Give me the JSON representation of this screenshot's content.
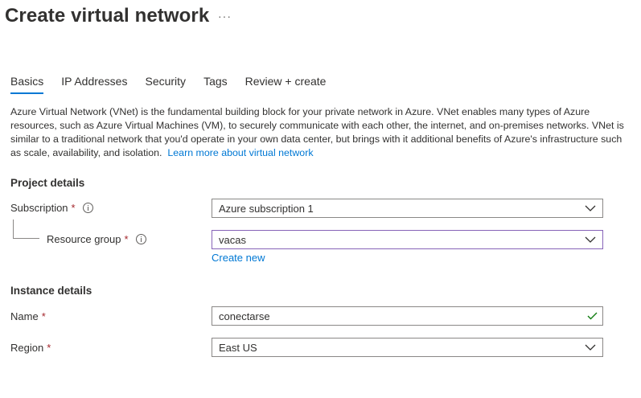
{
  "page": {
    "title": "Create virtual network",
    "more_label": "···"
  },
  "tabs": [
    {
      "label": "Basics",
      "active": true
    },
    {
      "label": "IP Addresses",
      "active": false
    },
    {
      "label": "Security",
      "active": false
    },
    {
      "label": "Tags",
      "active": false
    },
    {
      "label": "Review + create",
      "active": false
    }
  ],
  "description": {
    "text": "Azure Virtual Network (VNet) is the fundamental building block for your private network in Azure. VNet enables many types of Azure resources, such as Azure Virtual Machines (VM), to securely communicate with each other, the internet, and on-premises networks. VNet is similar to a traditional network that you'd operate in your own data center, but brings with it additional benefits of Azure's infrastructure such as scale, availability, and isolation.",
    "link_label": "Learn more about virtual network"
  },
  "project_details": {
    "heading": "Project details",
    "subscription": {
      "label": "Subscription",
      "required_mark": "*",
      "value": "Azure subscription 1",
      "info_icon": "info-icon"
    },
    "resource_group": {
      "label": "Resource group",
      "required_mark": "*",
      "value": "vacas",
      "info_icon": "info-icon",
      "create_new_label": "Create new"
    }
  },
  "instance_details": {
    "heading": "Instance details",
    "name": {
      "label": "Name",
      "required_mark": "*",
      "value": "conectarse",
      "status_icon": "check-icon"
    },
    "region": {
      "label": "Region",
      "required_mark": "*",
      "value": "East US"
    }
  },
  "colors": {
    "accent": "#0078d4",
    "required": "#a4262c",
    "valid": "#107c10",
    "focus_border": "#8764b8",
    "text": "#323130"
  }
}
